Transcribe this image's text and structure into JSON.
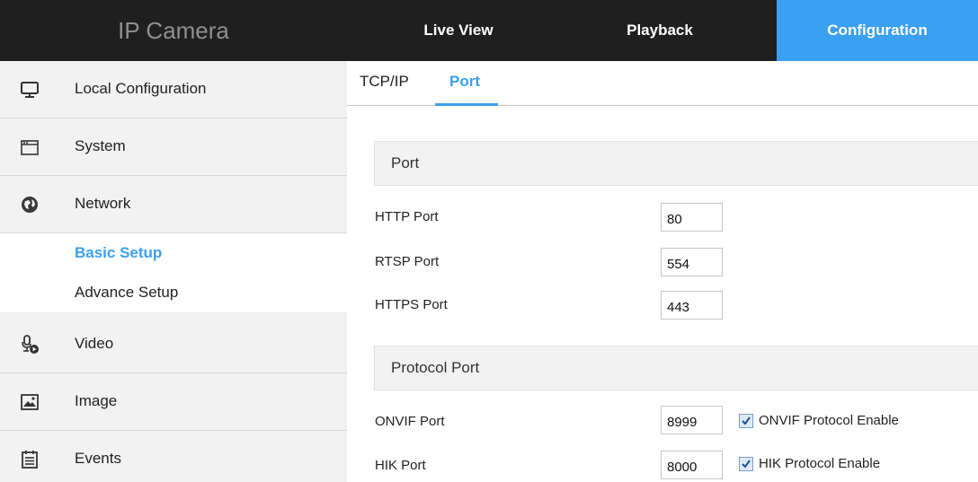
{
  "app": {
    "title": "IP Camera"
  },
  "nav": {
    "live_view": "Live View",
    "playback": "Playback",
    "configuration": "Configuration"
  },
  "colors": {
    "accent": "#3ba0f0",
    "topbar": "#1f1f1f",
    "sidebar": "#f2f2f2"
  },
  "sidebar": {
    "items": [
      {
        "label": "Local Configuration",
        "icon": "monitor-icon"
      },
      {
        "label": "System",
        "icon": "window-icon"
      },
      {
        "label": "Network",
        "icon": "globe-icon"
      },
      {
        "label": "Video",
        "icon": "microphone-video-icon"
      },
      {
        "label": "Image",
        "icon": "image-icon"
      },
      {
        "label": "Events",
        "icon": "calendar-icon"
      }
    ],
    "network_sub": [
      {
        "label": "Basic Setup",
        "active": true
      },
      {
        "label": "Advance Setup",
        "active": false
      }
    ]
  },
  "tabs": [
    {
      "label": "TCP/IP",
      "active": false
    },
    {
      "label": "Port",
      "active": true
    }
  ],
  "port_section": {
    "title": "Port",
    "fields": [
      {
        "label": "HTTP Port",
        "value": "80"
      },
      {
        "label": "RTSP Port",
        "value": "554"
      },
      {
        "label": "HTTPS Port",
        "value": "443"
      }
    ]
  },
  "protocol_section": {
    "title": "Protocol Port",
    "fields": [
      {
        "label": "ONVIF Port",
        "value": "8999",
        "checkbox_label": "ONVIF Protocol Enable",
        "checked": true
      },
      {
        "label": "HIK Port",
        "value": "8000",
        "checkbox_label": "HIK Protocol Enable",
        "checked": true
      }
    ]
  }
}
